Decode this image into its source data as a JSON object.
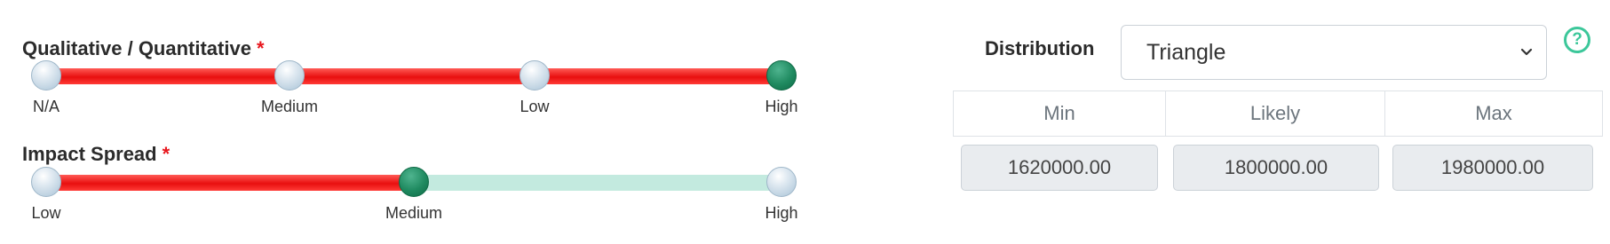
{
  "qualitative": {
    "label": "Qualitative / Quantitative",
    "required_mark": "*",
    "ticks": [
      "N/A",
      "Medium",
      "Low",
      "High"
    ],
    "selected": "High"
  },
  "impact_spread": {
    "label": "Impact Spread",
    "required_mark": "*",
    "ticks": [
      "Low",
      "Medium",
      "High"
    ],
    "selected": "Medium"
  },
  "distribution": {
    "label": "Distribution",
    "selected": "Triangle",
    "help_icon": "question-circle-icon"
  },
  "estimates": {
    "headers": [
      "Min",
      "Likely",
      "Max"
    ],
    "values": [
      "1620000.00",
      "1800000.00",
      "1980000.00"
    ]
  },
  "colors": {
    "fill": "#e80f0f",
    "track": "#c3eadf",
    "active_knob": "#1f8a60",
    "required": "#e8161d",
    "help": "#3cc79a"
  }
}
